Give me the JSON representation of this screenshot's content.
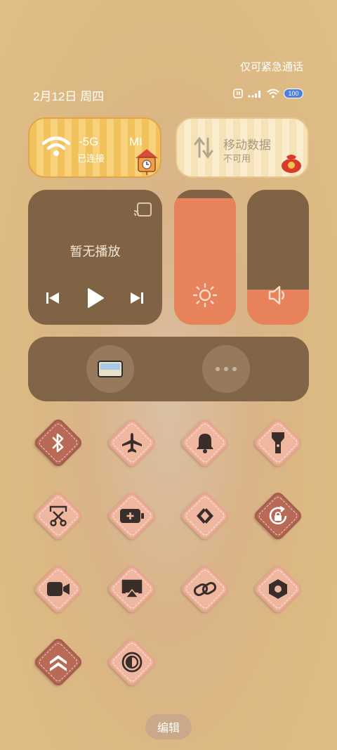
{
  "status": {
    "notice": "仅可紧急通话",
    "date": "2月12日 周四",
    "battery": "100"
  },
  "wifi_tile": {
    "title": "-5G",
    "prefix": "MI",
    "subtitle": "已连接"
  },
  "data_tile": {
    "title": "移动数据",
    "subtitle": "不可用"
  },
  "media": {
    "status": "暂无播放"
  },
  "brightness": {
    "level": 0.94
  },
  "volume": {
    "level": 0.26
  },
  "toggles": [
    {
      "name": "bluetooth",
      "active": true
    },
    {
      "name": "airplane",
      "active": false
    },
    {
      "name": "bell",
      "active": false
    },
    {
      "name": "flashlight",
      "active": false
    },
    {
      "name": "screenshot",
      "active": false
    },
    {
      "name": "battery-saver",
      "active": false
    },
    {
      "name": "nearby-share",
      "active": false
    },
    {
      "name": "rotation-lock",
      "active": true
    },
    {
      "name": "video",
      "active": false
    },
    {
      "name": "screencast",
      "active": false
    },
    {
      "name": "link",
      "active": false
    },
    {
      "name": "settings",
      "active": false
    },
    {
      "name": "performance",
      "active": true
    },
    {
      "name": "dark-mode",
      "active": false
    }
  ],
  "footer": {
    "edit_label": "编辑"
  },
  "colors": {
    "tile_dark": "#7f6344",
    "accent": "#e8825a",
    "toggle_on": "#b86a57",
    "toggle_off": "#f0b7a0"
  }
}
